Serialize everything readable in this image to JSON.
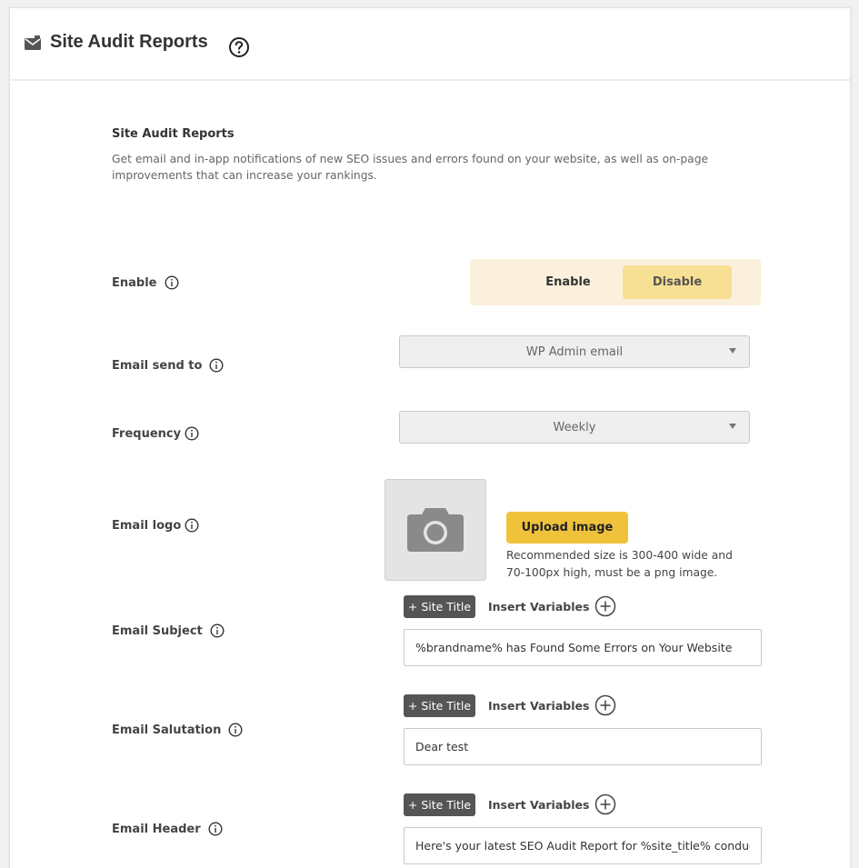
{
  "header": {
    "title": "Site Audit Reports",
    "icon": "envelope-icon",
    "help_icon": "help-circle-icon"
  },
  "section": {
    "title": "Site Audit Reports",
    "description": "Get email and in-app notifications of new SEO issues and errors found on your website, as well as on-page improvements that can increase your rankings."
  },
  "fields": {
    "enable": {
      "label": "Enable",
      "options": [
        "Enable",
        "Disable"
      ],
      "selected": "Disable"
    },
    "email_send_to": {
      "label": "Email send to",
      "value": "WP Admin email"
    },
    "frequency": {
      "label": "Frequency",
      "value": "Weekly"
    },
    "email_logo": {
      "label": "Email logo",
      "upload_label": "Upload image",
      "hint": "Recommended size is 300-400 wide and 70-100px high, must be a png image."
    },
    "email_subject": {
      "label": "Email Subject",
      "value": "%brandname% has Found Some Errors on Your Website"
    },
    "email_salutation": {
      "label": "Email Salutation",
      "value": "Dear test"
    },
    "email_header": {
      "label": "Email Header",
      "value": "Here's your latest SEO Audit Report for %site_title% conducted on"
    }
  },
  "variables": {
    "chip_label": "+ Site Title",
    "insert_label": "Insert Variables"
  },
  "colors": {
    "accent": "#f0c23b",
    "toggle_bg": "#fbf0dc",
    "toggle_selected": "#f7df94",
    "chip_bg": "#555555"
  }
}
